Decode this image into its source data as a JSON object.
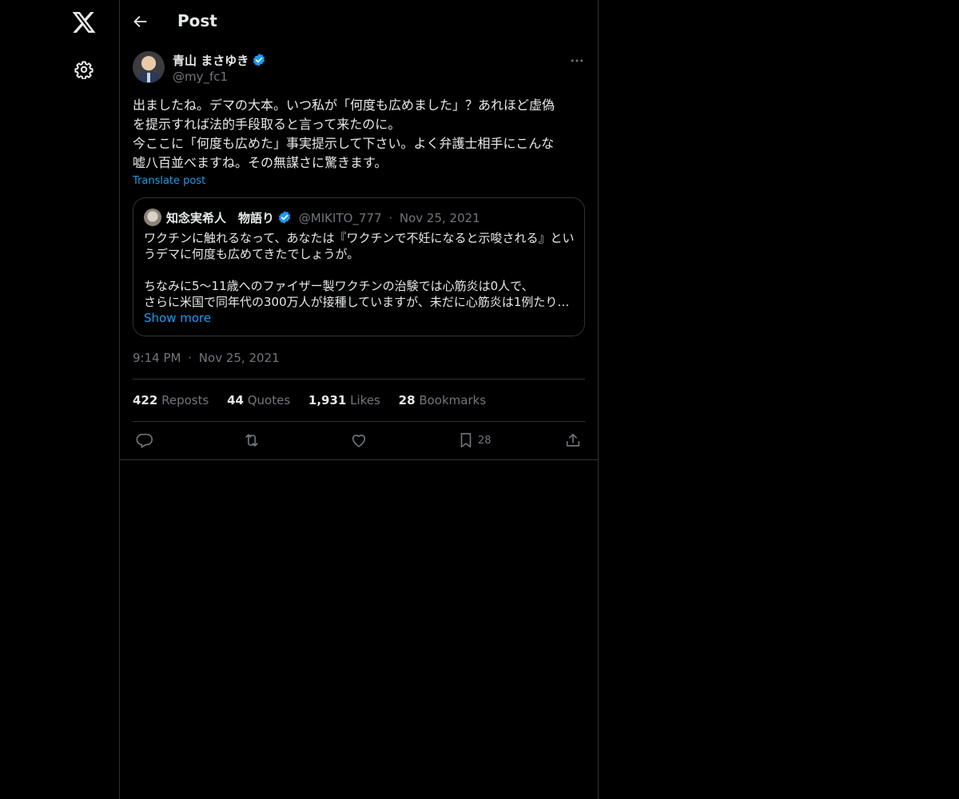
{
  "nav": {
    "logo_icon": "x-logo-icon",
    "settings_icon": "gear-icon"
  },
  "header": {
    "back_icon": "arrow-left-icon",
    "title": "Post"
  },
  "post": {
    "author_name": "青山 まさゆき",
    "author_handle": "@my_fc1",
    "verified": true,
    "body_lines": [
      "出ましたね。デマの大本。いつ私が「何度も広めました」？あれほど虚偽",
      "を提示すれば法的手段取ると言って来たのに。",
      "今ここに「何度も広めた」事実提示して下さい。よく弁護士相手にこんな",
      "嘘八百並べますね。その無謀さに驚きます。"
    ],
    "translate_label": "Translate post",
    "quote": {
      "author_name": "知念実希人　物語り",
      "author_handle": "@MIKITO_777",
      "separator": "·",
      "date": "Nov 25, 2021",
      "lines": [
        "ワクチンに触れるなって、あなたは『ワクチンで不妊になると示唆される』とい",
        "うデマに何度も広めてきたでしょうが。",
        "",
        "ちなみに5〜11歳へのファイザー製ワクチンの治験では心筋炎は0人で、",
        "さらに米国で同年代の300万人が接種していますが、未だに心筋炎は1例たり…"
      ],
      "show_more": "Show more"
    },
    "time": "9:14 PM",
    "separator": "·",
    "date": "Nov 25, 2021",
    "stats": {
      "reposts_count": "422",
      "reposts_label": "Reposts",
      "quotes_count": "44",
      "quotes_label": "Quotes",
      "likes_count": "1,931",
      "likes_label": "Likes",
      "bookmarks_count": "28",
      "bookmarks_label": "Bookmarks"
    },
    "actions": {
      "bookmark_count": "28"
    }
  },
  "colors": {
    "background": "#000000",
    "text": "#e7e9ea",
    "muted": "#71767b",
    "accent": "#1d9bf0",
    "border": "#2f3336"
  }
}
